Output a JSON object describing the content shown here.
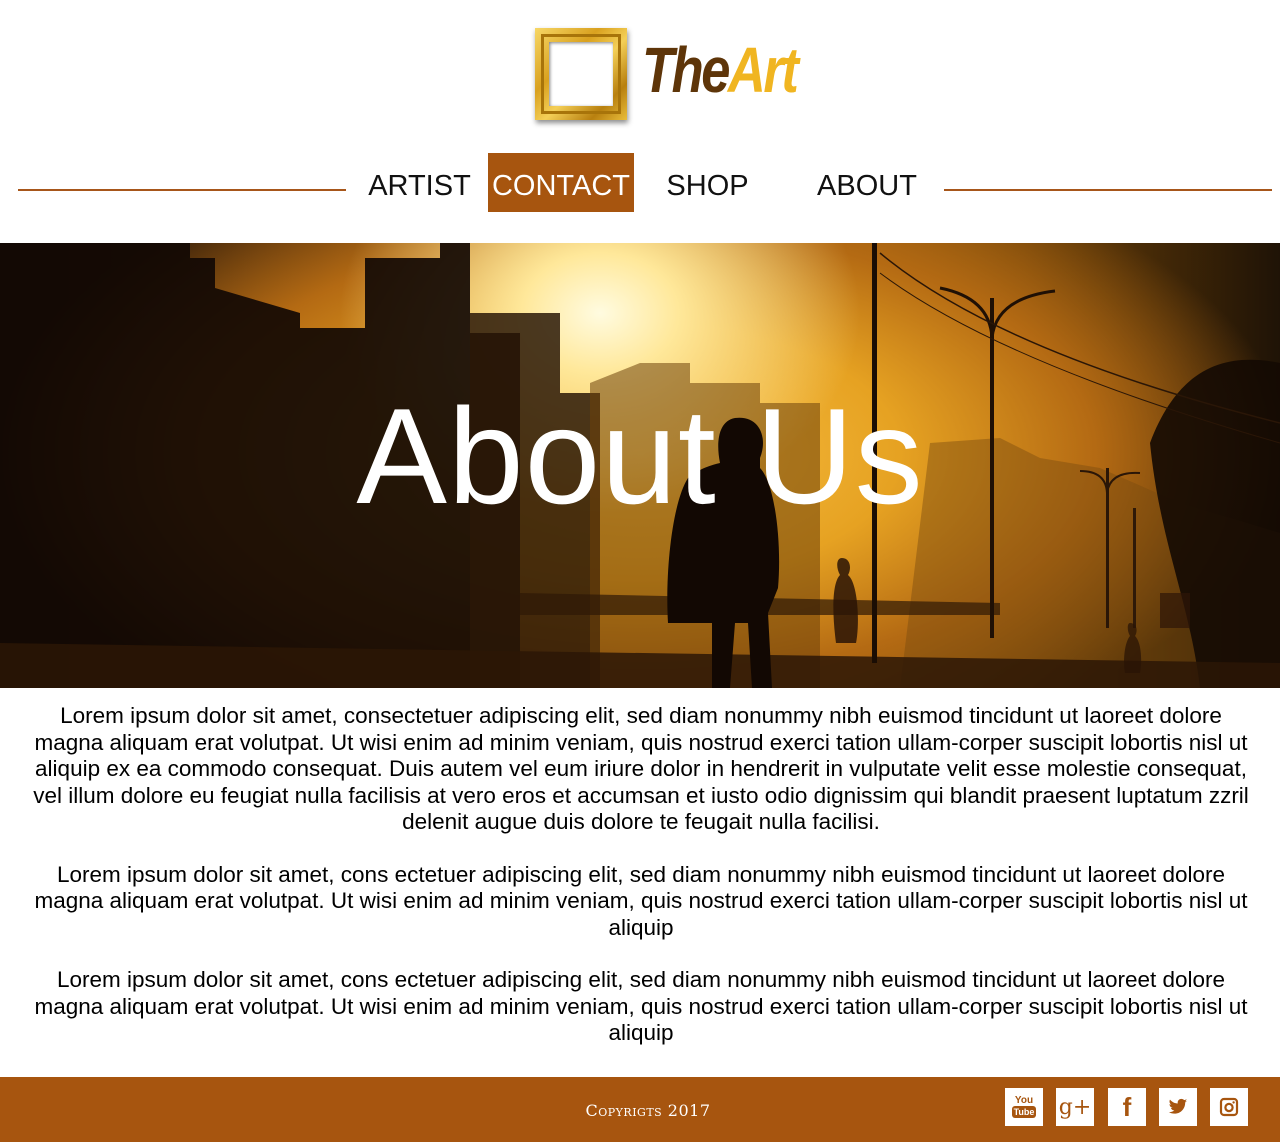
{
  "brand": {
    "name_part1": "The",
    "name_part2": "Art",
    "frame_icon": "picture-frame-icon"
  },
  "nav": {
    "items": [
      {
        "label": "ARTIST",
        "active": false
      },
      {
        "label": "CONTACT",
        "active": true
      },
      {
        "label": "SHOP",
        "active": false
      },
      {
        "label": "ABOUT",
        "active": false
      }
    ]
  },
  "hero": {
    "title": "About Us"
  },
  "content": {
    "paragraphs": [
      "Lorem ipsum dolor sit amet, consectetuer adipiscing elit, sed diam nonummy nibh euismod tincidunt ut laoreet dolore magna aliquam erat volutpat. Ut wisi enim ad minim veniam, quis nostrud exerci tation ullam-corper suscipit lobortis nisl ut aliquip ex ea commodo consequat. Duis autem vel eum iriure dolor in hendrerit in vulputate velit esse molestie consequat, vel illum dolore eu feugiat nulla facilisis at vero eros et accumsan et iusto odio dignissim qui blandit praesent luptatum zzril delenit augue duis dolore te feugait nulla facilisi.",
      "Lorem ipsum dolor sit amet, cons ectetuer adipiscing elit, sed diam nonummy nibh euismod tincidunt ut laoreet dolore magna aliquam erat volutpat. Ut wisi enim ad minim veniam, quis nostrud exerci tation ullam-corper suscipit lobortis nisl ut aliquip",
      "Lorem ipsum dolor sit amet, cons ectetuer adipiscing elit, sed diam nonummy nibh euismod tincidunt ut laoreet dolore magna aliquam erat volutpat. Ut wisi enim ad minim veniam, quis nostrud exerci tation ullam-corper suscipit lobortis nisl ut aliquip"
    ]
  },
  "footer": {
    "copyright": "Copyrigts 2017",
    "social": [
      {
        "icon": "youtube-icon",
        "glyph_top": "You",
        "glyph_bottom": "Tube"
      },
      {
        "icon": "google-plus-icon",
        "glyph": "g+"
      },
      {
        "icon": "facebook-icon",
        "glyph": "f"
      },
      {
        "icon": "twitter-icon",
        "glyph": ""
      },
      {
        "icon": "instagram-icon",
        "glyph": ""
      }
    ]
  },
  "colors": {
    "accent": "#a7550f",
    "nav_line": "#a7561a",
    "logo_dark": "#5e3509",
    "logo_gold": "#f0b521",
    "text": "#111111",
    "footer_text": "#ffffff"
  }
}
